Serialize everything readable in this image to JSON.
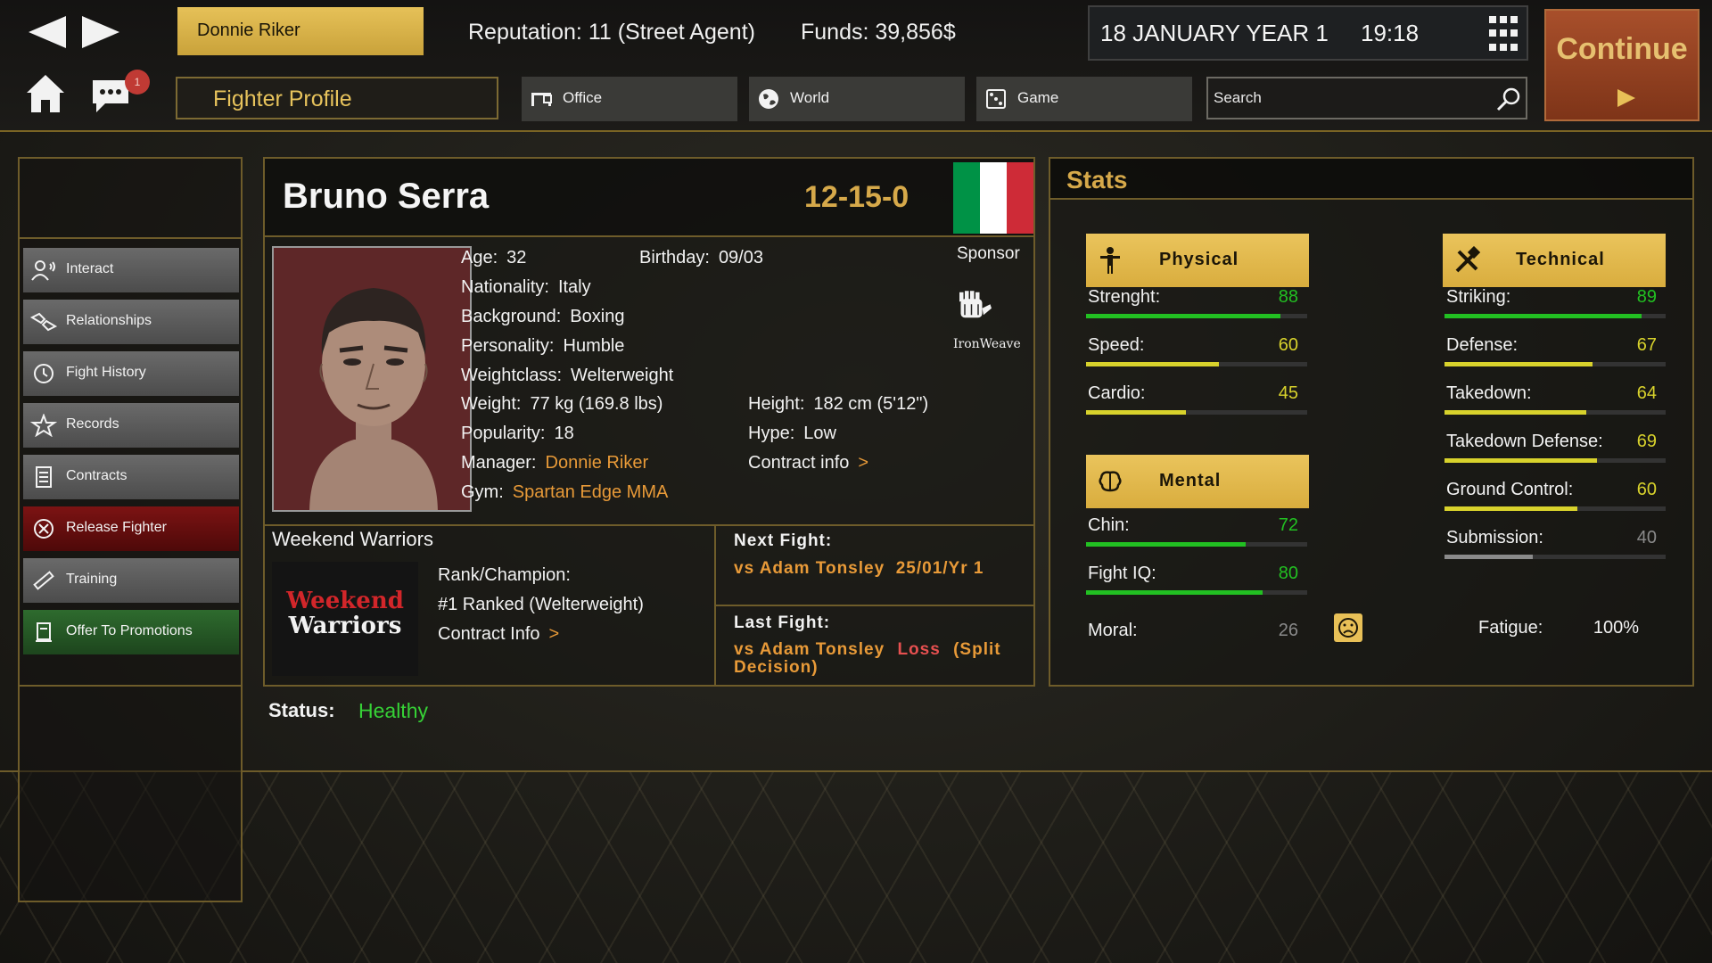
{
  "topbar": {
    "manager_name": "Donnie Riker",
    "reputation": "Reputation: 11 (Street Agent)",
    "funds": "Funds: 39,856$",
    "date": "18 JANUARY YEAR 1",
    "time": "19:18",
    "continue_label": "Continue",
    "chat_badge": "1",
    "section_title": "Fighter Profile",
    "tabs": [
      {
        "label": "Office",
        "icon": "office-icon"
      },
      {
        "label": "World",
        "icon": "globe-icon"
      },
      {
        "label": "Game",
        "icon": "dice-icon"
      }
    ],
    "search_placeholder": "Search"
  },
  "sidebar": {
    "items": [
      {
        "label": "Interact",
        "icon": "interact-icon",
        "style": "default"
      },
      {
        "label": "Relationships",
        "icon": "handshake-icon",
        "style": "default"
      },
      {
        "label": "Fight History",
        "icon": "history-icon",
        "style": "default"
      },
      {
        "label": "Records",
        "icon": "star-icon",
        "style": "default"
      },
      {
        "label": "Contracts",
        "icon": "document-icon",
        "style": "default"
      },
      {
        "label": "Release Fighter",
        "icon": "cancel-icon",
        "style": "danger"
      },
      {
        "label": "Training",
        "icon": "training-icon",
        "style": "default"
      },
      {
        "label": "Offer To Promotions",
        "icon": "offer-icon",
        "style": "success"
      }
    ]
  },
  "fighter": {
    "name": "Bruno Serra",
    "record": "12-15-0",
    "flag_colors": [
      "#009246",
      "#ffffff",
      "#ce2b37"
    ],
    "age_label": "Age:",
    "age": "32",
    "birthday_label": "Birthday:",
    "birthday": "09/03",
    "nationality_label": "Nationality:",
    "nationality": "Italy",
    "background_label": "Background:",
    "background": "Boxing",
    "personality_label": "Personality:",
    "personality": "Humble",
    "weightclass_label": "Weightclass:",
    "weightclass": "Welterweight",
    "weight_label": "Weight:",
    "weight": "77 kg (169.8 lbs)",
    "height_label": "Height:",
    "height": "182 cm (5'12\")",
    "popularity_label": "Popularity:",
    "popularity": "18",
    "hype_label": "Hype:",
    "hype": "Low",
    "manager_label": "Manager:",
    "manager": "Donnie Riker",
    "contract_info_label": "Contract info",
    "gym_label": "Gym:",
    "gym": "Spartan Edge MMA",
    "sponsor_label": "Sponsor",
    "sponsor_name": "IronWeave",
    "status_label": "Status:",
    "status": "Healthy"
  },
  "promotion": {
    "name": "Weekend Warriors",
    "logo_line1": "Weekend",
    "logo_line2": "Warriors",
    "rank_label": "Rank/Champion:",
    "rank": "#1 Ranked (Welterweight)",
    "contract_info_label": "Contract Info",
    "next_fight_label": "Next Fight:",
    "next_fight": "vs Adam Tonsley  25/01/Yr 1",
    "last_fight_label": "Last Fight:",
    "last_fight_opponent": "vs Adam Tonsley",
    "last_fight_result": "Loss",
    "last_fight_method_a": "(Split",
    "last_fight_method_b": "Decision)"
  },
  "stats": {
    "title": "Stats",
    "physical_label": "Physical",
    "technical_label": "Technical",
    "mental_label": "Mental",
    "physical": [
      {
        "name": "Strenght:",
        "value": 88
      },
      {
        "name": "Speed:",
        "value": 60
      },
      {
        "name": "Cardio:",
        "value": 45
      }
    ],
    "mental": [
      {
        "name": "Chin:",
        "value": 72
      },
      {
        "name": "Fight IQ:",
        "value": 80
      }
    ],
    "technical": [
      {
        "name": "Striking:",
        "value": 89
      },
      {
        "name": "Defense:",
        "value": 67
      },
      {
        "name": "Takedown:",
        "value": 64
      },
      {
        "name": "Takedown Defense:",
        "value": 69
      },
      {
        "name": "Ground Control:",
        "value": 60
      },
      {
        "name": "Submission:",
        "value": 40
      }
    ],
    "moral_label": "Moral:",
    "moral": 26,
    "moral_icon": "sad-face-icon",
    "fatigue_label": "Fatigue:",
    "fatigue": "100%",
    "colors": {
      "high": "#22c022",
      "mid": "#d8d22c",
      "low": "#8a8a8a"
    }
  }
}
